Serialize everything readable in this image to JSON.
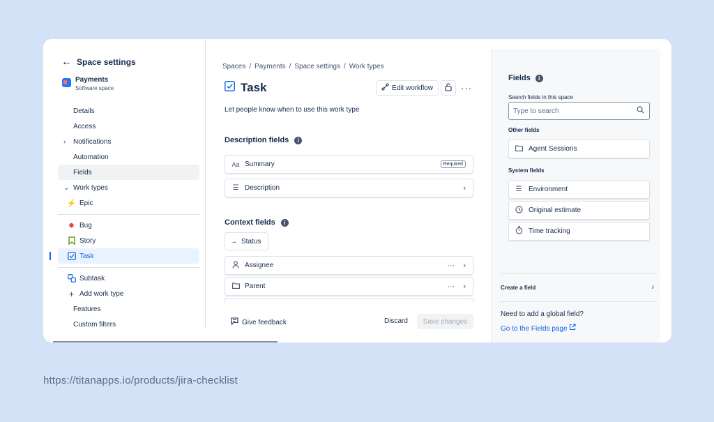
{
  "sidebar": {
    "back_label": "←",
    "title": "Space settings",
    "project": {
      "name": "Payments",
      "type": "Software space"
    },
    "nav": {
      "details": "Details",
      "access": "Access",
      "notifications": "Notifications",
      "automation": "Automation",
      "fields": "Fields",
      "work_types": "Work types",
      "epic": "Epic",
      "bug": "Bug",
      "story": "Story",
      "task": "Task",
      "subtask": "Subtask",
      "add_work_type": "Add work type",
      "features": "Features",
      "custom_filters": "Custom filters"
    }
  },
  "breadcrumb": [
    "Spaces",
    "Payments",
    "Space settings",
    "Work types"
  ],
  "breadcrumb_sep": "/",
  "header": {
    "title": "Task",
    "edit_workflow": "Edit workflow",
    "more": "···"
  },
  "main": {
    "description": "Let people know when to use this work type",
    "description_fields_title": "Description fields",
    "description_fields": [
      {
        "label": "Summary",
        "badge": "Required"
      },
      {
        "label": "Description"
      }
    ],
    "context_fields_title": "Context fields",
    "status_label": "Status",
    "context_fields": [
      {
        "label": "Assignee",
        "more": "···"
      },
      {
        "label": "Parent",
        "more": "···"
      }
    ],
    "give_feedback": "Give feedback",
    "discard": "Discard",
    "save_changes": "Save changes"
  },
  "panel": {
    "title": "Fields",
    "search_label": "Search fields in this space",
    "search_placeholder": "Type to search",
    "other_fields_label": "Other fields",
    "other_fields": [
      "Agent Sessions"
    ],
    "system_fields_label": "System fields",
    "system_fields": [
      "Environment",
      "Original estimate",
      "Time tracking"
    ],
    "create_field": "Create a field",
    "global_question": "Need to add a global field?",
    "global_link": "Go to the Fields page"
  },
  "url": "https://titanapps.io/products/jira-checklist",
  "colors": {
    "background": "#d3e2f7",
    "accent": "#0c66e4",
    "text": "#172b4d"
  }
}
